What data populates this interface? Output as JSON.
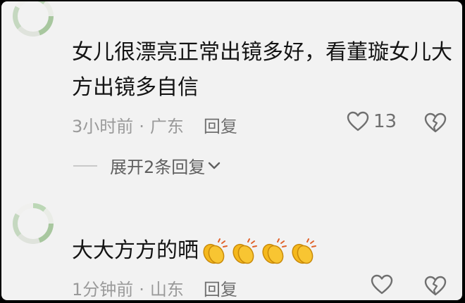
{
  "comments": [
    {
      "text": "女儿很漂亮正常出镜多好，看董璇女儿大方出镜多自信",
      "time": "3小时前",
      "location": "广东",
      "reply_label": "回复",
      "likes": "13",
      "expand_label": "展开2条回复"
    },
    {
      "text": "大大方方的晒",
      "time": "1分钟前",
      "location": "山东",
      "reply_label": "回复",
      "likes": ""
    }
  ],
  "icons": {
    "like": "heart-outline-icon",
    "dislike": "broken-heart-outline-icon",
    "expand": "chevron-down-icon",
    "emoji": "clapping-hands-emoji"
  },
  "colors": {
    "background": "#f2f2f2",
    "text": "#141414",
    "meta": "#9a9a9a",
    "icon": "#6f6f6f",
    "emoji": "#f5b81c"
  }
}
